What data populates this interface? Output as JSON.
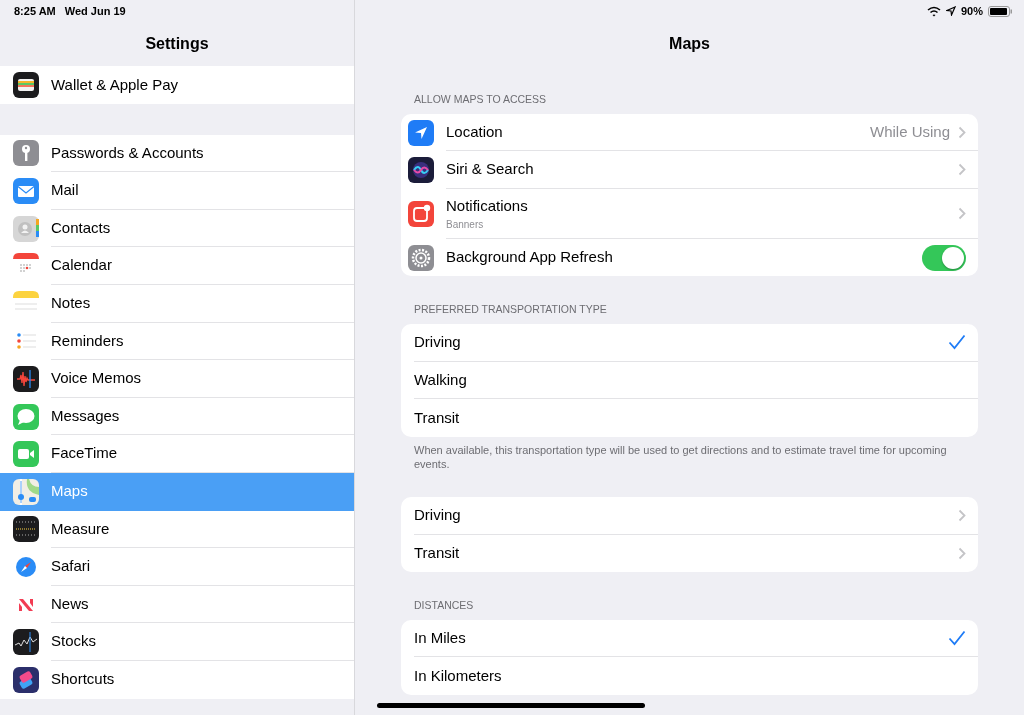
{
  "status_bar": {
    "time": "8:25 AM",
    "date": "Wed Jun 19",
    "battery": "90%"
  },
  "sidebar": {
    "title": "Settings",
    "groups": [
      {
        "items": [
          {
            "label": "Wallet & Apple Pay",
            "selected": false
          }
        ]
      },
      {
        "items": [
          {
            "label": "Passwords & Accounts",
            "selected": false
          },
          {
            "label": "Mail",
            "selected": false
          },
          {
            "label": "Contacts",
            "selected": false
          },
          {
            "label": "Calendar",
            "selected": false
          },
          {
            "label": "Notes",
            "selected": false
          },
          {
            "label": "Reminders",
            "selected": false
          },
          {
            "label": "Voice Memos",
            "selected": false
          },
          {
            "label": "Messages",
            "selected": false
          },
          {
            "label": "FaceTime",
            "selected": false
          },
          {
            "label": "Maps",
            "selected": true
          },
          {
            "label": "Measure",
            "selected": false
          },
          {
            "label": "Safari",
            "selected": false
          },
          {
            "label": "News",
            "selected": false
          },
          {
            "label": "Stocks",
            "selected": false
          },
          {
            "label": "Shortcuts",
            "selected": false
          }
        ]
      }
    ]
  },
  "detail": {
    "title": "Maps",
    "sections": [
      {
        "header": "ALLOW MAPS TO ACCESS",
        "rows": [
          {
            "kind": "nav",
            "label": "Location",
            "value": "While Using"
          },
          {
            "kind": "nav",
            "label": "Siri & Search"
          },
          {
            "kind": "nav",
            "label": "Notifications",
            "subtitle": "Banners"
          },
          {
            "kind": "toggle",
            "label": "Background App Refresh",
            "on": true
          }
        ]
      },
      {
        "header": "PREFERRED TRANSPORTATION TYPE",
        "rows": [
          {
            "kind": "check",
            "label": "Driving",
            "selected": true
          },
          {
            "kind": "check",
            "label": "Walking",
            "selected": false
          },
          {
            "kind": "check",
            "label": "Transit",
            "selected": false
          }
        ],
        "footer": "When available, this transportation type will be used to get directions and to estimate travel time for upcoming events."
      },
      {
        "rows": [
          {
            "kind": "nav",
            "label": "Driving"
          },
          {
            "kind": "nav",
            "label": "Transit"
          }
        ]
      },
      {
        "header": "DISTANCES",
        "rows": [
          {
            "kind": "check",
            "label": "In Miles",
            "selected": true
          },
          {
            "kind": "check",
            "label": "In Kilometers",
            "selected": false
          }
        ]
      }
    ]
  }
}
